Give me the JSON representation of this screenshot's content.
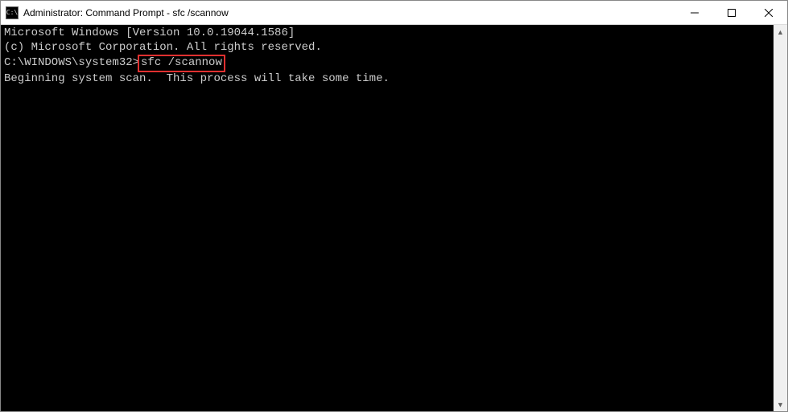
{
  "window": {
    "title": "Administrator: Command Prompt - sfc  /scannow",
    "icon_label": "C:\\"
  },
  "terminal": {
    "line1": "Microsoft Windows [Version 10.0.19044.1586]",
    "line2": "(c) Microsoft Corporation. All rights reserved.",
    "blank1": "",
    "prompt": "C:\\WINDOWS\\system32>",
    "command": "sfc /scannow",
    "blank2": "",
    "status": "Beginning system scan.  This process will take some time."
  },
  "controls": {
    "minimize": "minimize",
    "maximize": "maximize",
    "close": "close"
  }
}
